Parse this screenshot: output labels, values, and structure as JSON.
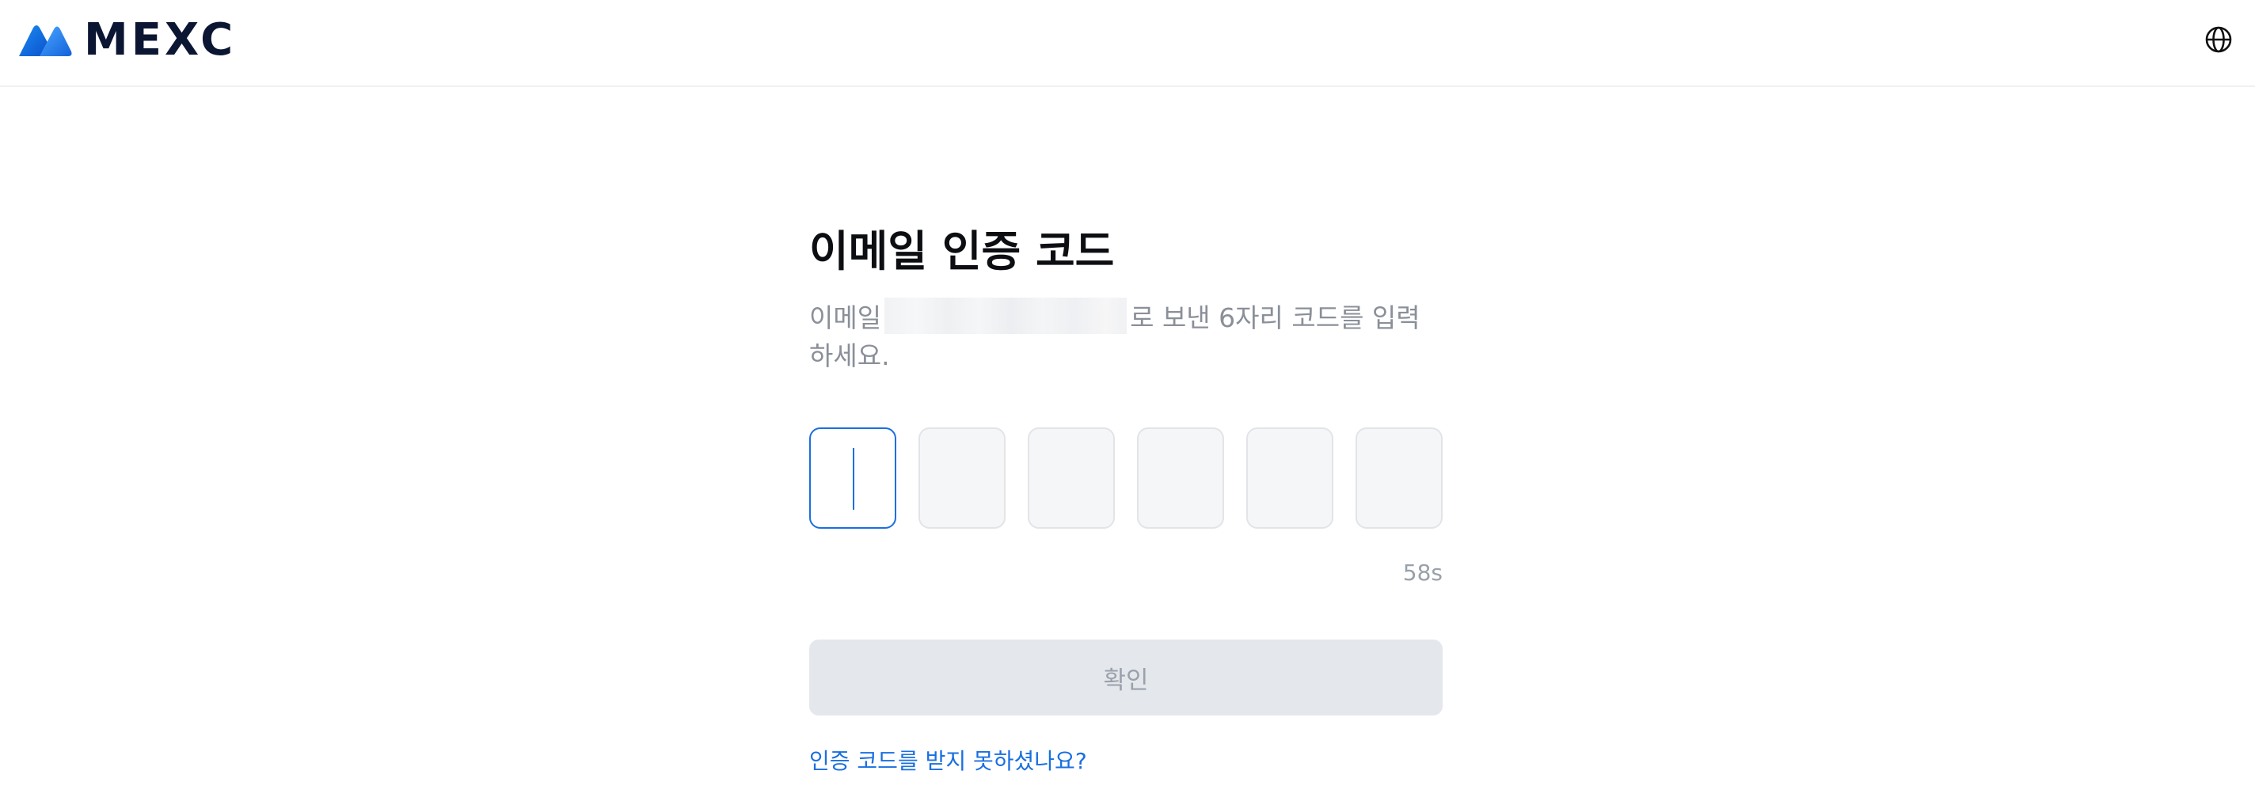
{
  "header": {
    "logo_text": "MEXC",
    "language_icon": "globe-icon"
  },
  "verification": {
    "title": "이메일 인증 코드",
    "subtitle_prefix": "이메일",
    "subtitle_suffix": "로 보낸 6자리 코드를 입력하세요.",
    "code_boxes": [
      "",
      "",
      "",
      "",
      "",
      ""
    ],
    "active_box_index": 0,
    "countdown": "58s",
    "confirm_label": "확인",
    "help_link": "인증 코드를 받지 못하셨나요?"
  },
  "colors": {
    "accent": "#1a6fe0",
    "brand_dark": "#0b1633",
    "button_disabled_bg": "#e4e7eb"
  }
}
